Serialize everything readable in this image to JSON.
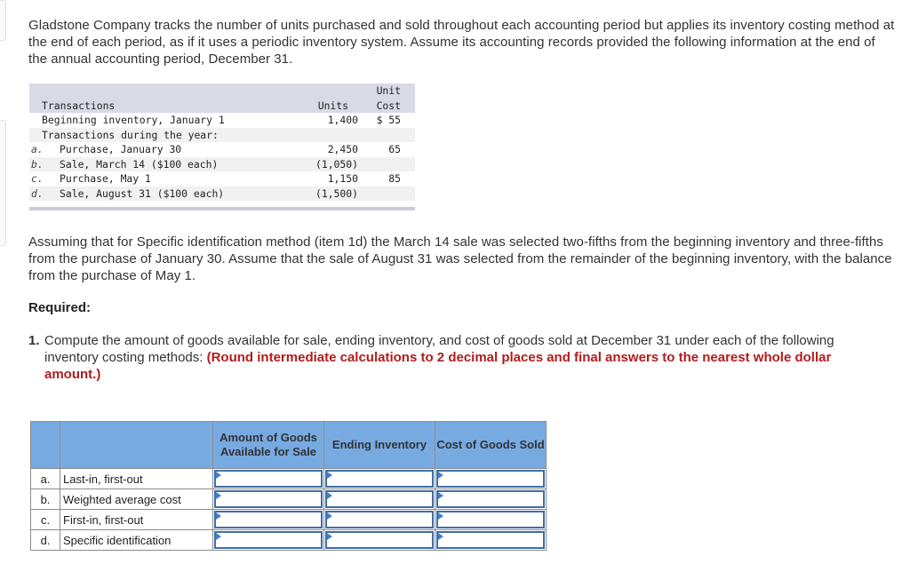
{
  "intro": "Gladstone Company tracks the number of units purchased and sold throughout each accounting period but applies its inventory costing method at the end of each period, as if it uses a periodic inventory system. Assume its accounting records provided the following information at the end of the annual accounting period, December 31.",
  "transactions_table": {
    "headers": {
      "label": "Transactions",
      "units": "Units",
      "cost_line1": "Unit",
      "cost_line2": "Cost"
    },
    "rows": [
      {
        "letter": "",
        "label": "Beginning inventory, January 1",
        "units": "1,400",
        "cost": "$ 55"
      },
      {
        "letter": "",
        "label": "Transactions during the year:",
        "units": "",
        "cost": ""
      },
      {
        "letter": "a.",
        "label": "Purchase, January 30",
        "units": "2,450",
        "cost": "65"
      },
      {
        "letter": "b.",
        "label": "Sale, March 14 ($100 each)",
        "units": "(1,050)",
        "cost": ""
      },
      {
        "letter": "c.",
        "label": "Purchase, May 1",
        "units": "1,150",
        "cost": "85"
      },
      {
        "letter": "d.",
        "label": "Sale, August 31 ($100 each)",
        "units": "(1,500)",
        "cost": ""
      }
    ]
  },
  "assumption": "Assuming that for Specific identification method (item 1d) the March 14 sale was selected two-fifths from the beginning inventory and three-fifths from the purchase of January 30. Assume that the sale of August 31 was selected from the remainder of the beginning inventory, with the balance from the purchase of May 1.",
  "required_label": "Required:",
  "item1": {
    "number": "1.",
    "text": "Compute the amount of goods available for sale, ending inventory, and cost of goods sold at December 31 under each of the following inventory costing methods:",
    "instruction": "(Round intermediate calculations to 2 decimal places and final answers to the nearest whole dollar amount.)"
  },
  "answer_table": {
    "headers": [
      "Amount of Goods Available for Sale",
      "Ending Inventory",
      "Cost of Goods Sold"
    ],
    "rows": [
      {
        "letter": "a.",
        "method": "Last-in, first-out",
        "values": [
          "",
          "",
          ""
        ]
      },
      {
        "letter": "b.",
        "method": "Weighted average cost",
        "values": [
          "",
          "",
          ""
        ]
      },
      {
        "letter": "c.",
        "method": "First-in, first-out",
        "values": [
          "",
          "",
          ""
        ]
      },
      {
        "letter": "d.",
        "method": "Specific identification",
        "values": [
          "",
          "",
          ""
        ]
      }
    ]
  },
  "colors": {
    "header_blue": "#78aae2",
    "input_border": "#3f6ea6",
    "instruction_red": "#b31b1b",
    "txn_header": "#d8dbe6"
  }
}
